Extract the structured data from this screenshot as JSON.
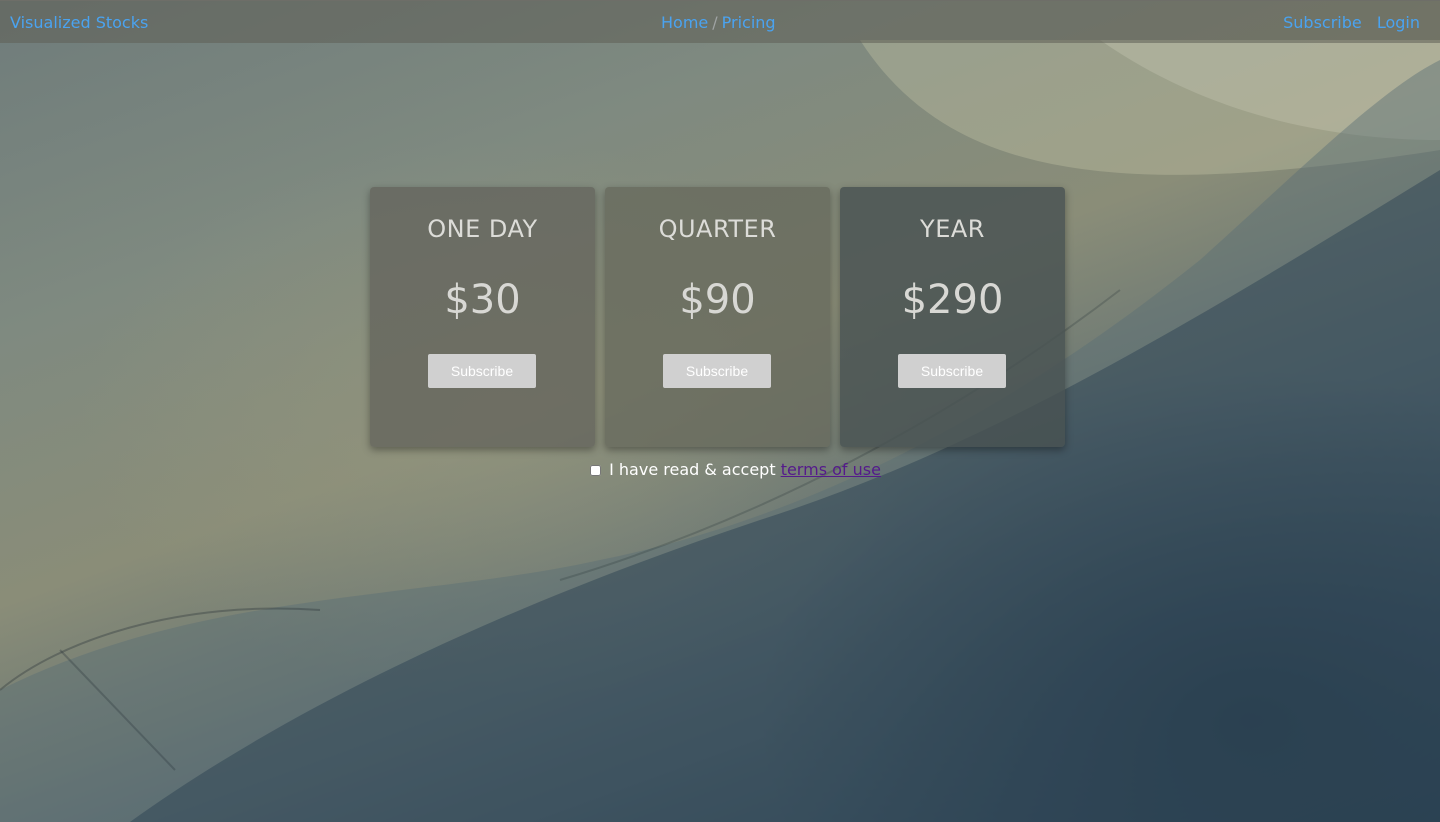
{
  "navbar": {
    "brand": "Visualized Stocks",
    "breadcrumb": {
      "home": "Home",
      "separator": "/",
      "current": "Pricing"
    },
    "right_links": {
      "subscribe": "Subscribe",
      "login": "Login"
    },
    "link_color": "#4aa3f0"
  },
  "plans": [
    {
      "name": "ONE DAY",
      "price": "$30",
      "button_label": "Subscribe"
    },
    {
      "name": "QUARTER",
      "price": "$90",
      "button_label": "Subscribe"
    },
    {
      "name": "YEAR",
      "price": "$290",
      "button_label": "Subscribe"
    }
  ],
  "terms": {
    "checked": false,
    "text": "I have read & accept",
    "link_text": "terms of use",
    "link_color": "#551a8b"
  }
}
